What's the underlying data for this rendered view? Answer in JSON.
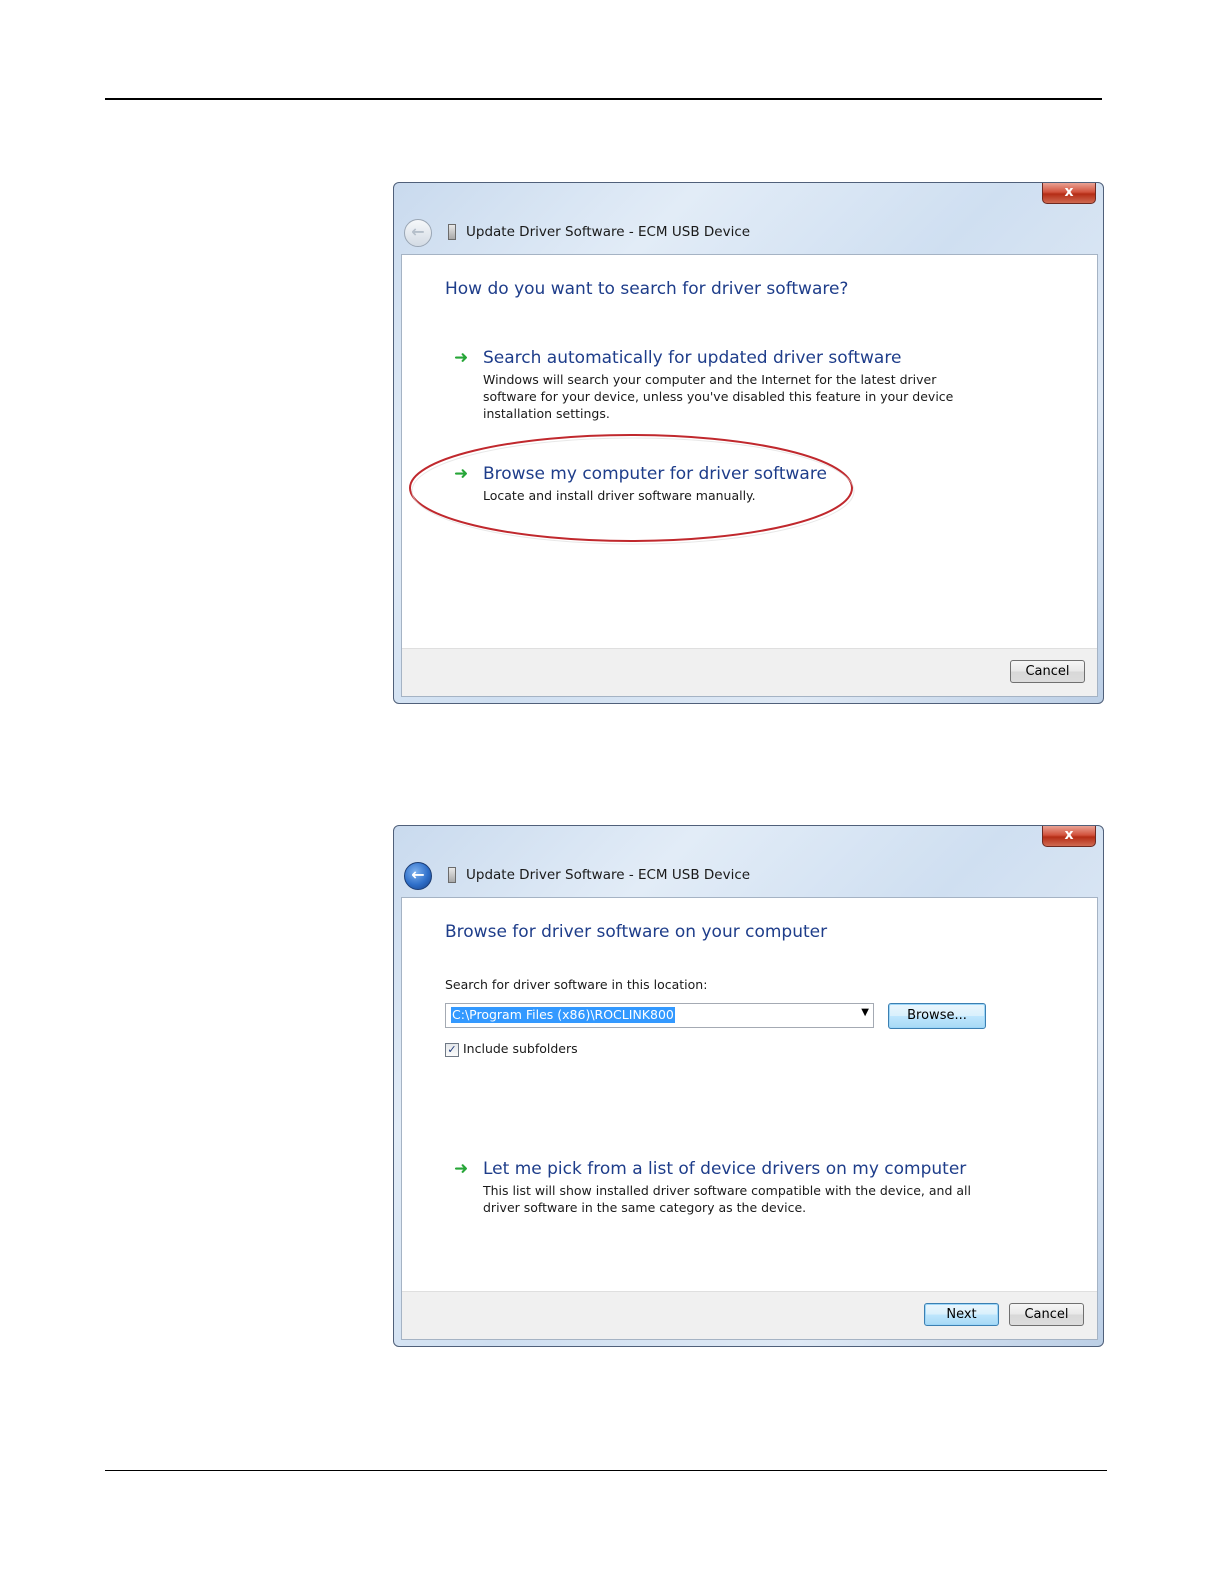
{
  "dialog1": {
    "close_glyph": "x",
    "title": "Update Driver Software - ECM USB Device",
    "heading": "How do you want to search for driver software?",
    "options": [
      {
        "title": "Search automatically for updated driver software",
        "description": "Windows will search your computer and the Internet for the latest driver software for your device, unless you've disabled this feature in your device installation settings."
      },
      {
        "title": "Browse my computer for driver software",
        "description": "Locate and install driver software manually."
      }
    ],
    "cancel_label": "Cancel",
    "highlight_color": "#c0282d"
  },
  "dialog2": {
    "close_glyph": "x",
    "title": "Update Driver Software - ECM USB Device",
    "heading": "Browse for driver software on your computer",
    "location_label": "Search for driver software in this location:",
    "location_value": "C:\\Program Files (x86)\\ROCLINK800",
    "browse_label": "Browse...",
    "include_subfolders_label": "Include subfolders",
    "include_subfolders_checked": true,
    "option": {
      "title": "Let me pick from a list of device drivers on my computer",
      "description": "This list will show installed driver software compatible with the device, and all driver software in the same category as the device."
    },
    "next_label": "Next",
    "cancel_label": "Cancel"
  },
  "icons": [
    "close-icon",
    "back-arrow-icon",
    "usb-device-icon",
    "green-arrow-icon",
    "checkmark-icon",
    "dropdown-arrow-icon"
  ],
  "colors": {
    "heading": "#1e3d8a",
    "arrow": "#27a638",
    "selection": "#3399ff"
  }
}
